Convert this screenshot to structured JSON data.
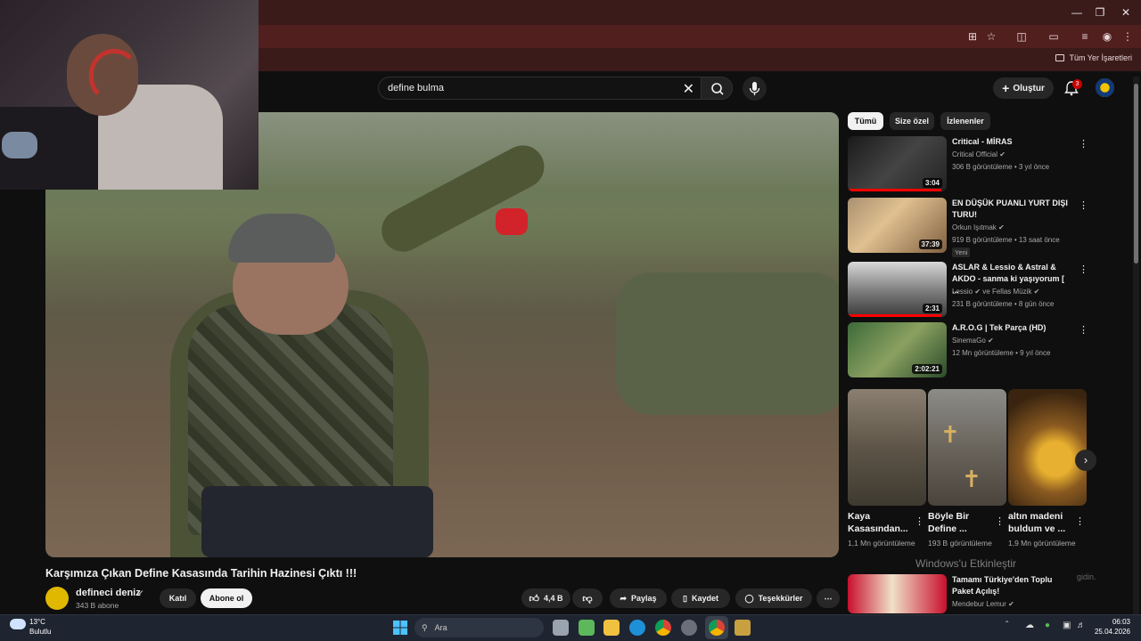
{
  "browser": {
    "bookmarks_folder": "Tüm Yer İşaretleri"
  },
  "search": {
    "query": "define bulma"
  },
  "masthead": {
    "create_label": "Oluştur",
    "notification_count": "3"
  },
  "video": {
    "title": "Karşımıza Çıkan Define Kasasında Tarihin Hazinesi Çıktı !!!",
    "channel": "defineci deniz",
    "subscribers": "343 B abone",
    "join_label": "Katıl",
    "subscribe_label": "Abone ol",
    "likes": "4,4 B",
    "share_label": "Paylaş",
    "save_label": "Kaydet",
    "thanks_label": "Teşekkürler"
  },
  "chips": [
    "Tümü",
    "Size özel",
    "İzlenenler"
  ],
  "recommendations": [
    {
      "title": "Critical - MİRAS",
      "channel": "Critical Official",
      "meta": "306 B görüntüleme • 3 yıl önce",
      "duration": "3:04",
      "progress": 0.95
    },
    {
      "title": "EN DÜŞÜK PUANLI YURT DIŞI TURU!",
      "channel": "Orkun Işıtmak",
      "meta": "919 B görüntüleme • 13 saat önce",
      "duration": "37:39",
      "badge": "Yeni"
    },
    {
      "title": "ASLAR & Lessio & Astral & AKDO - sanma ki yaşıyorum [ ...",
      "channel": "Lessio",
      "channel_extra": "ve Fellas Müzik",
      "meta": "231 B görüntüleme • 8 gün önce",
      "duration": "2:31",
      "progress": 0.95
    },
    {
      "title": "A.R.O.G | Tek Parça (HD)",
      "channel": "SinemaGo",
      "meta": "12 Mn görüntüleme • 9 yıl önce",
      "duration": "2:02:21"
    }
  ],
  "shorts": [
    {
      "title": "Kaya Kasasından...",
      "views": "1,1 Mn görüntüleme"
    },
    {
      "title": "Böyle Bir Define ...",
      "views": "193 B görüntüleme"
    },
    {
      "title": "altın madeni buldum ve ...",
      "views": "1,9 Mn görüntüleme"
    }
  ],
  "bottom_rec": {
    "title": "Tamamı Türkiye'den Toplu Paket Açılış!",
    "channel": "Mendebur Lemur"
  },
  "watermark": "Windows'u Etkinleştir",
  "watermark_sub": "gidin.",
  "taskbar": {
    "temperature": "13°C",
    "weather": "Bulutlu",
    "search_placeholder": "Ara",
    "time": "06:03",
    "date": "25.04.2026"
  },
  "colors": {
    "titlebar": "#3b1a1a",
    "accent_red": "#ff0000",
    "background": "#0f0f0f"
  }
}
